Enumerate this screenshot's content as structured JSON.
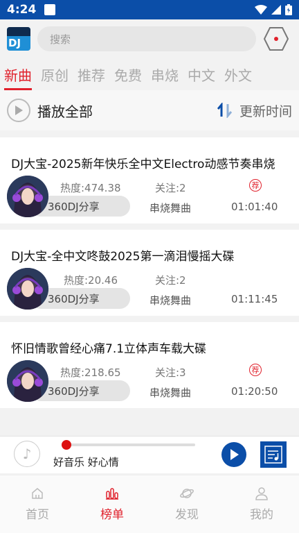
{
  "status_bar": {
    "time": "4:24"
  },
  "search": {
    "placeholder": "搜索"
  },
  "tabs": [
    {
      "label": "新曲",
      "active": true
    },
    {
      "label": "原创",
      "active": false
    },
    {
      "label": "推荐",
      "active": false
    },
    {
      "label": "免费",
      "active": false
    },
    {
      "label": "串烧",
      "active": false
    },
    {
      "label": "中文",
      "active": false
    },
    {
      "label": "外文",
      "active": false
    }
  ],
  "play_all": {
    "label": "播放全部",
    "sort_label": "更新时间"
  },
  "songs": [
    {
      "title": "DJ大宝-2025新年快乐全中文Electro动感节奏串烧",
      "heat": "热度:474.38",
      "follow": "关注:2",
      "source": "360DJ分享",
      "genre": "串烧舞曲",
      "duration": "01:01:40",
      "recommended": true,
      "recommend_badge": "荐"
    },
    {
      "title": "DJ大宝-全中文咚鼓2025第一滴泪慢摇大碟",
      "heat": "热度:20.46",
      "follow": "关注:2",
      "source": "360DJ分享",
      "genre": "串烧舞曲",
      "duration": "01:11:45",
      "recommended": false,
      "recommend_badge": ""
    },
    {
      "title": "怀旧情歌曾经心痛7.1立体声车载大碟",
      "heat": "热度:218.65",
      "follow": "关注:3",
      "source": "360DJ分享",
      "genre": "串烧舞曲",
      "duration": "01:20:50",
      "recommended": true,
      "recommend_badge": "荐"
    }
  ],
  "player": {
    "now_playing": "好音乐 好心情",
    "progress": 0.0
  },
  "bottom_nav": [
    {
      "label": "首页",
      "icon": "home-icon",
      "active": false
    },
    {
      "label": "榜单",
      "icon": "chart-icon",
      "active": true
    },
    {
      "label": "发现",
      "icon": "planet-icon",
      "active": false
    },
    {
      "label": "我的",
      "icon": "user-icon",
      "active": false
    }
  ],
  "colors": {
    "brand_blue": "#0b4ea8",
    "accent_red": "#e0202b"
  }
}
